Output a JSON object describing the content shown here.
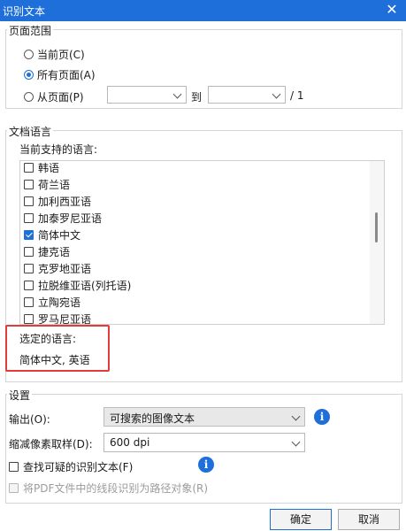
{
  "window": {
    "title": "识别文本",
    "close_glyph": "✕"
  },
  "page_range": {
    "legend": "页面范围",
    "options": [
      "当前页(C)",
      "所有页面(A)",
      "从页面(P)"
    ],
    "selected_index": 1,
    "to_label": "到",
    "total": "/ 1",
    "from_value": "",
    "to_value": ""
  },
  "language": {
    "legend": "文档语言",
    "supported_label": "当前支持的语言:",
    "items": [
      {
        "label": "韩语",
        "checked": false
      },
      {
        "label": "荷兰语",
        "checked": false
      },
      {
        "label": "加利西亚语",
        "checked": false
      },
      {
        "label": "加泰罗尼亚语",
        "checked": false
      },
      {
        "label": "简体中文",
        "checked": true
      },
      {
        "label": "捷克语",
        "checked": false
      },
      {
        "label": "克罗地亚语",
        "checked": false
      },
      {
        "label": "拉脱维亚语(列托语)",
        "checked": false
      },
      {
        "label": "立陶宛语",
        "checked": false
      },
      {
        "label": "罗马尼亚语",
        "checked": false
      }
    ],
    "selected_label": "选定的语言:",
    "selected_value": "简体中文, 英语"
  },
  "settings": {
    "legend": "设置",
    "output_label": "输出(O):",
    "output_value": "可搜索的图像文本",
    "downsample_label": "缩减像素取样(D):",
    "downsample_value": "600 dpi",
    "suspect_label": "查找可疑的识别文本(F)",
    "vector_label": "将PDF文件中的线段识别为路径对象(R)"
  },
  "buttons": {
    "ok": "确定",
    "cancel": "取消"
  },
  "colors": {
    "accent": "#1e6fd9",
    "highlight": "#e33a3a"
  }
}
